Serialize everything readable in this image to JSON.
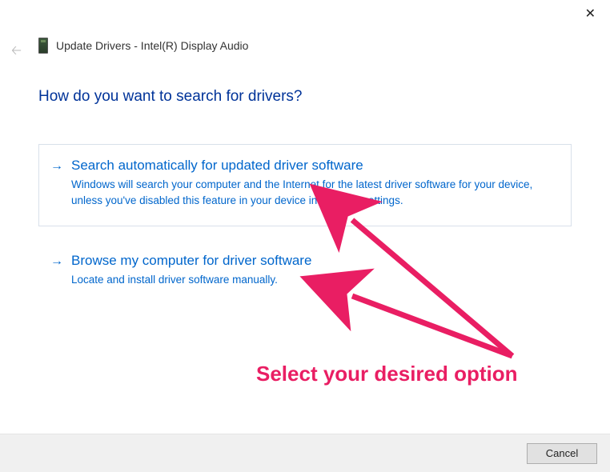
{
  "window": {
    "title": "Update Drivers - Intel(R) Display Audio"
  },
  "heading": "How do you want to search for drivers?",
  "options": [
    {
      "title": "Search automatically for updated driver software",
      "desc": "Windows will search your computer and the Internet for the latest driver software for your device, unless you've disabled this feature in your device installation settings."
    },
    {
      "title": "Browse my computer for driver software",
      "desc": "Locate and install driver software manually."
    }
  ],
  "buttons": {
    "cancel": "Cancel"
  },
  "annotation": {
    "text": "Select your desired option"
  }
}
